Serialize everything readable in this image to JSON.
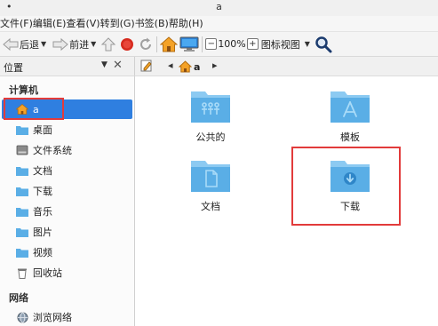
{
  "window": {
    "dot": "•",
    "title": "a"
  },
  "menu": [
    "文件(F)",
    "编辑(E)",
    "查看(V)",
    "转到(G)",
    "书签(B)",
    "帮助(H)"
  ],
  "toolbar": {
    "back_label": "后退",
    "forward_label": "前进",
    "zoom_out_symbol": "−",
    "zoom_level": "100%",
    "zoom_in_symbol": "+",
    "view_mode": "图标视图"
  },
  "side_header": {
    "label": "位置",
    "caret": "▼",
    "close": "✕"
  },
  "path": {
    "left_arrow": "◂",
    "location": "a",
    "right_arrow": "▸"
  },
  "sidebar": {
    "computer_section": "计算机",
    "items": [
      {
        "label": "a",
        "icon": "home-icon"
      },
      {
        "label": "桌面",
        "icon": "folder-icon"
      },
      {
        "label": "文件系统",
        "icon": "drive-icon"
      },
      {
        "label": "文档",
        "icon": "folder-icon"
      },
      {
        "label": "下载",
        "icon": "folder-icon"
      },
      {
        "label": "音乐",
        "icon": "folder-icon"
      },
      {
        "label": "图片",
        "icon": "folder-icon"
      },
      {
        "label": "视频",
        "icon": "folder-icon"
      },
      {
        "label": "回收站",
        "icon": "trash-icon"
      }
    ],
    "network_section": "网络",
    "network_items": [
      {
        "label": "浏览网络",
        "icon": "network-icon"
      }
    ]
  },
  "files": [
    {
      "label": "公共的",
      "icon": "folder-public-icon"
    },
    {
      "label": "模板",
      "icon": "folder-templates-icon"
    },
    {
      "label": "文档",
      "icon": "folder-documents-icon"
    },
    {
      "label": "下载",
      "icon": "folder-download-icon"
    }
  ],
  "colors": {
    "selection": "#2f7fe0",
    "folder": "#5aaee6",
    "folder_tab": "#8ccaf2",
    "highlight_box": "#e23b3b"
  }
}
